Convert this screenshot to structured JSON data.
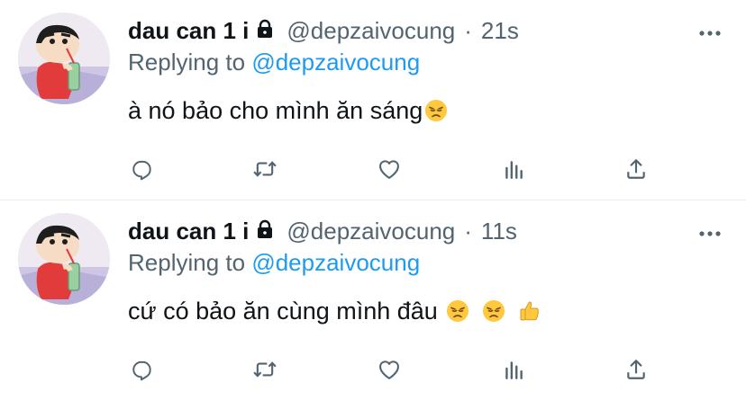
{
  "colors": {
    "text": "#0f1419",
    "muted": "#536471",
    "link": "#1d9bf0",
    "divider": "#e6ecf0"
  },
  "icons": [
    "lock-icon",
    "more-icon",
    "reply-icon",
    "retweet-icon",
    "like-icon",
    "analytics-icon",
    "share-icon",
    "disappointed-face-emoji",
    "thumbs-up-emoji"
  ],
  "tweets": [
    {
      "display_name": "dau can 1 i",
      "handle": "@depzaivocung",
      "separator": "·",
      "time": "21s",
      "replying_prefix": "Replying to",
      "replying_to": "@depzaivocung",
      "text": "à nó bảo cho mình ăn sáng",
      "emojis": [
        "disappointed-face"
      ]
    },
    {
      "display_name": "dau can 1 i",
      "handle": "@depzaivocung",
      "separator": "·",
      "time": "11s",
      "replying_prefix": "Replying to",
      "replying_to": "@depzaivocung",
      "text": "cứ có bảo ăn cùng mình đâu",
      "emojis": [
        "disappointed-face",
        "disappointed-face",
        "thumbs-up"
      ]
    }
  ]
}
